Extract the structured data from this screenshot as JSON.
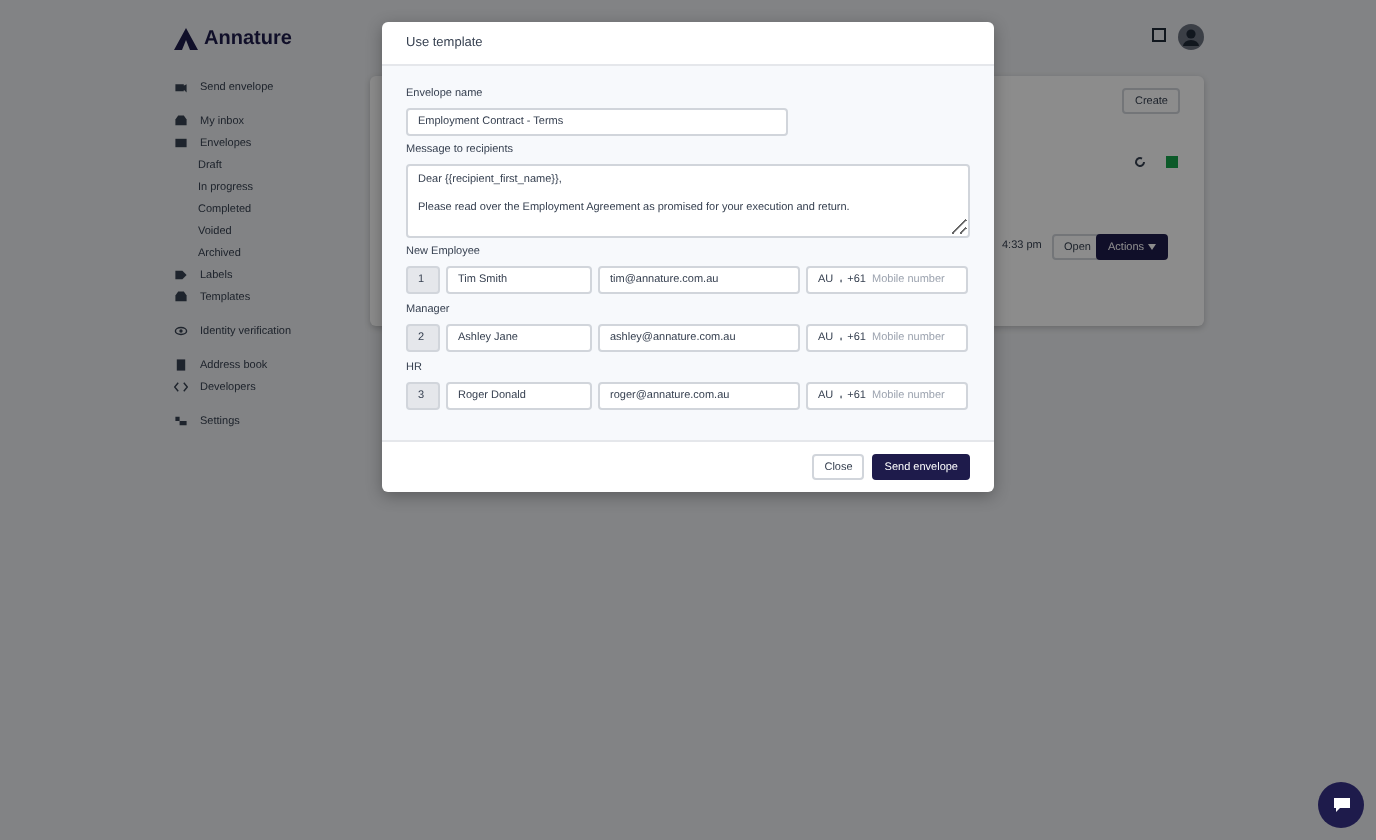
{
  "logo": "Annature",
  "sidebar": {
    "items": [
      {
        "label": "Send envelope"
      },
      {
        "label": "My inbox"
      },
      {
        "label": "Envelopes",
        "children": [
          {
            "label": "Draft"
          },
          {
            "label": "In progress"
          },
          {
            "label": "Completed"
          },
          {
            "label": "Voided"
          },
          {
            "label": "Archived"
          }
        ]
      },
      {
        "label": "Labels"
      },
      {
        "label": "Templates"
      },
      {
        "label": "Identity verification"
      },
      {
        "label": "Address book"
      },
      {
        "label": "Developers"
      },
      {
        "label": "Settings"
      }
    ]
  },
  "background": {
    "create_button": "Create",
    "row_time": "4:33 pm",
    "open_button": "Open",
    "actions_button": "Actions"
  },
  "modal": {
    "title": "Use template",
    "envelope_name_label": "Envelope name",
    "envelope_name": "Employment Contract - Terms",
    "message_label": "Message to recipients",
    "message": "Dear {{recipient_first_name}},\n\nPlease read over the Employment Agreement as promised for your execution and return.",
    "recipients": [
      {
        "role": "New Employee",
        "number": "1",
        "name": "Tim Smith",
        "email": "tim@annature.com.au",
        "country": "AU",
        "dial_code": "+61",
        "phone_placeholder": "Mobile number"
      },
      {
        "role": "Manager",
        "number": "2",
        "name": "Ashley Jane",
        "email": "ashley@annature.com.au",
        "country": "AU",
        "dial_code": "+61",
        "phone_placeholder": "Mobile number"
      },
      {
        "role": "HR",
        "number": "3",
        "name": "Roger Donald",
        "email": "roger@annature.com.au",
        "country": "AU",
        "dial_code": "+61",
        "phone_placeholder": "Mobile number"
      }
    ],
    "buttons": [
      {
        "label": "Close",
        "kind": "secondary"
      },
      {
        "label": "Send envelope",
        "kind": "primary"
      }
    ]
  }
}
